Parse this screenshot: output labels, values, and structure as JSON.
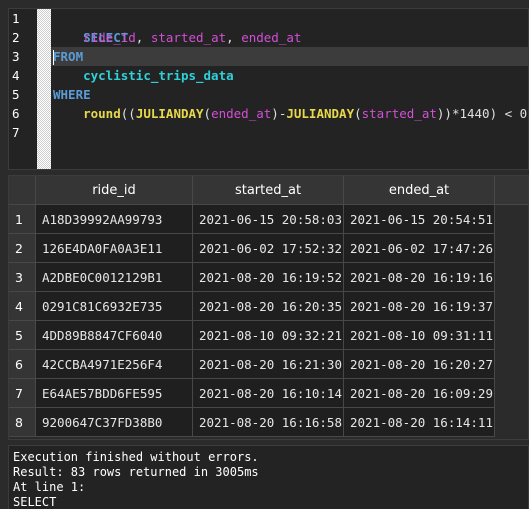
{
  "editor": {
    "line_numbers": [
      "1",
      "2",
      "3",
      "4",
      "5",
      "6",
      "7"
    ],
    "kw_select": "SELECT",
    "col_ride_id": "ride_id",
    "sep1": ", ",
    "col_started_at": "started_at",
    "sep2": ", ",
    "col_ended_at": "ended_at",
    "kw_from": "FROM",
    "table_name": "cyclistic_trips_data",
    "kw_where": "WHERE",
    "fn_round": "round",
    "p_open": "((",
    "fn_julianday_1": "JULIANDAY",
    "p1_open": "(",
    "arg_1": "ended_at",
    "p1_close": ")",
    "minus": "-",
    "fn_julianday_2": "JULIANDAY",
    "p2_open": "(",
    "arg_2": "started_at",
    "p_tail": "))*1440) < 0"
  },
  "results": {
    "columns": [
      "ride_id",
      "started_at",
      "ended_at"
    ],
    "rows": [
      {
        "n": "1",
        "ride_id": "A18D39992AA99793",
        "started_at": "2021-06-15 20:58:03",
        "ended_at": "2021-06-15 20:54:51"
      },
      {
        "n": "2",
        "ride_id": "126E4DA0FA0A3E11",
        "started_at": "2021-06-02 17:52:32",
        "ended_at": "2021-06-02 17:47:26"
      },
      {
        "n": "3",
        "ride_id": "A2DBE0C0012129B1",
        "started_at": "2021-08-20 16:19:52",
        "ended_at": "2021-08-20 16:19:16"
      },
      {
        "n": "4",
        "ride_id": "0291C81C6932E735",
        "started_at": "2021-08-20 16:20:35",
        "ended_at": "2021-08-20 16:19:37"
      },
      {
        "n": "5",
        "ride_id": "4DD89B8847CF6040",
        "started_at": "2021-08-10 09:32:21",
        "ended_at": "2021-08-10 09:31:11"
      },
      {
        "n": "6",
        "ride_id": "42CCBA4971E256F4",
        "started_at": "2021-08-20 16:21:30",
        "ended_at": "2021-08-20 16:20:27"
      },
      {
        "n": "7",
        "ride_id": "E64AE57BDD6FE595",
        "started_at": "2021-08-20 16:10:14",
        "ended_at": "2021-08-20 16:09:29"
      },
      {
        "n": "8",
        "ride_id": "9200647C37FD38B0",
        "started_at": "2021-08-20 16:16:58",
        "ended_at": "2021-08-20 16:14:11"
      }
    ]
  },
  "messages": {
    "line1": "Execution finished without errors.",
    "line2": "Result: 83 rows returned in 3005ms",
    "line3": "At line 1:",
    "line4": "SELECT"
  }
}
